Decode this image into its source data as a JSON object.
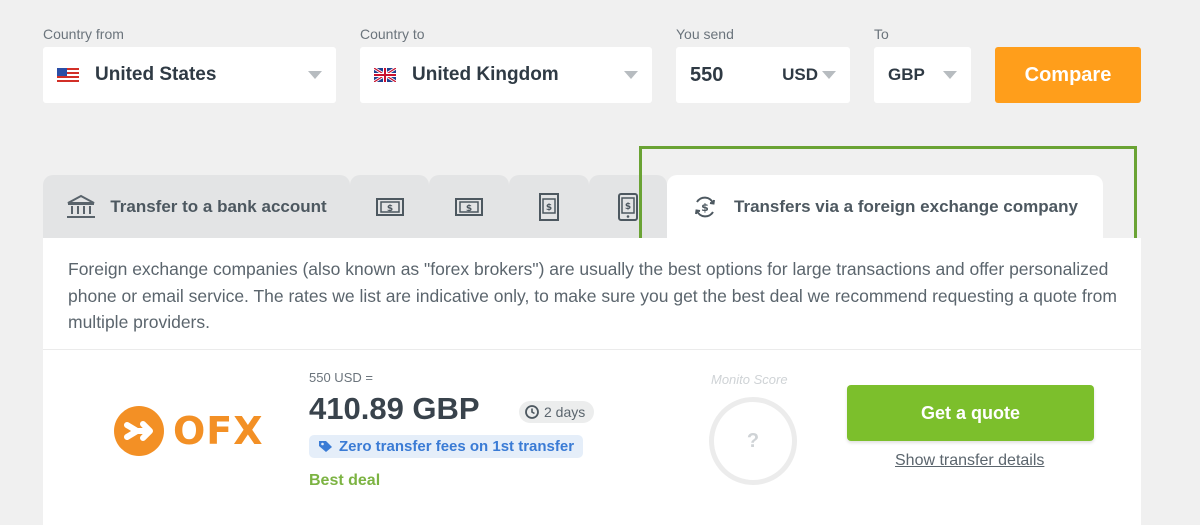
{
  "form": {
    "country_from": {
      "label": "Country from",
      "value": "United States"
    },
    "country_to": {
      "label": "Country to",
      "value": "United Kingdom"
    },
    "you_send": {
      "label": "You send",
      "amount": "550",
      "currency": "USD"
    },
    "to": {
      "label": "To",
      "currency": "GBP"
    },
    "compare_label": "Compare"
  },
  "tabs": [
    {
      "label": "Transfer to a bank account",
      "icon": "bank-icon"
    },
    {
      "label": "",
      "icon": "cash-icon"
    },
    {
      "label": "",
      "icon": "cash-icon"
    },
    {
      "label": "",
      "icon": "mobile-money-icon"
    },
    {
      "label": "",
      "icon": "mobile-phone-icon"
    },
    {
      "label": "Transfers via a foreign exchange company",
      "icon": "currency-exchange-icon",
      "active": true
    }
  ],
  "description": "Foreign exchange companies (also known as \"forex brokers\") are usually the best options for large transactions and offer personalized phone or email service. The rates we list are indicative only, to make sure you get the best deal we recommend requesting a quote from multiple providers.",
  "offer": {
    "provider": "OFX",
    "send_line": "550 USD =",
    "receive_amount": "410.89 GBP",
    "duration": "2 days",
    "promo": "Zero transfer fees on 1st transfer",
    "badge": "Best deal",
    "score_label": "Monito Score",
    "score_value": "?",
    "quote_button": "Get a quote",
    "details_link": "Show transfer details"
  },
  "colors": {
    "compare": "#ff9e1b",
    "quote": "#7cbf2c",
    "highlight": "#6aa334",
    "brand_ofx": "#f39025",
    "promo_text": "#3a7bd5"
  }
}
